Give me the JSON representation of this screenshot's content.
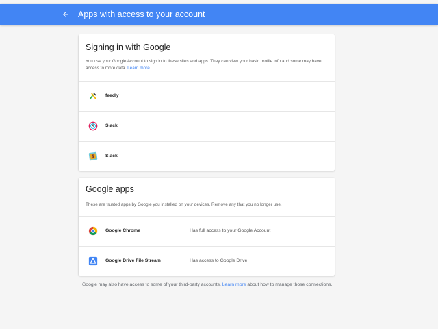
{
  "header": {
    "title": "Apps with access to your account",
    "back_icon": "arrow-left-icon",
    "background_color": "#4285f4"
  },
  "signin_card": {
    "title": "Signing in with Google",
    "description": "You use your Google Account to sign in to these sites and apps. They can view your basic profile info and some may have access to more data.",
    "learn_more": "Learn more",
    "apps": [
      {
        "name": "feedly",
        "icon": "feedly-icon"
      },
      {
        "name": "Slack",
        "icon": "slack-icon"
      },
      {
        "name": "Slack",
        "icon": "slack-icon"
      }
    ]
  },
  "google_apps_card": {
    "title": "Google apps",
    "description": "These are trusted apps by Google you installed on your devices. Remove any that you no longer use.",
    "apps": [
      {
        "name": "Google Chrome",
        "access": "Has full access to your Google Account",
        "icon": "chrome-icon"
      },
      {
        "name": "Google Drive File Stream",
        "access": "Has access to Google Drive",
        "icon": "drive-file-stream-icon"
      }
    ]
  },
  "footer": {
    "text_before": "Google may also have access to some of your third-party accounts.",
    "learn_more": "Learn more",
    "text_after": "about how to manage those connections."
  },
  "colors": {
    "accent": "#4285f4",
    "page_background": "#f5f5f5"
  }
}
